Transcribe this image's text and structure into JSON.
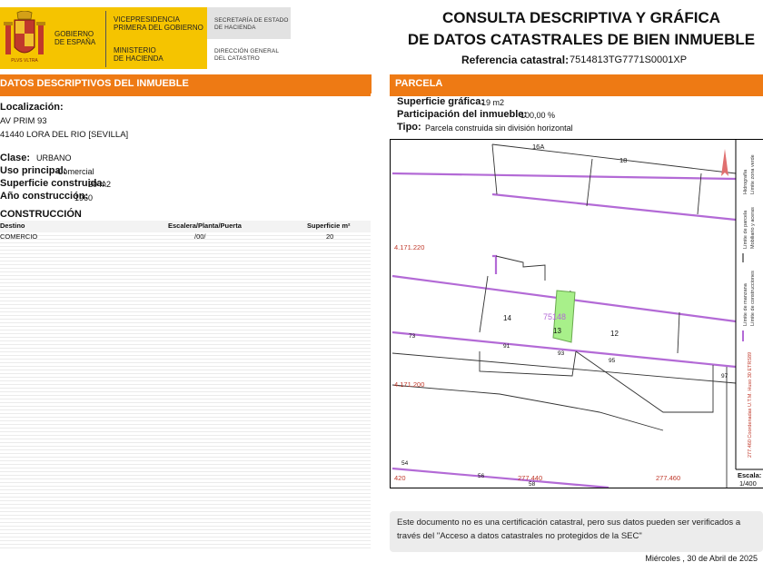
{
  "header": {
    "gov_line1": "GOBIERNO",
    "gov_line2": "DE ESPAÑA",
    "vice_line1": "VICEPRESIDENCIA",
    "vice_line2": "PRIMERA DEL GOBIERNO",
    "min_line1": "MINISTERIO",
    "min_line2": "DE HACIENDA",
    "secretaria_line1": "SECRETARÍA DE ESTADO",
    "secretaria_line2": "DE HACIENDA",
    "direccion_line1": "DIRECCIÓN GENERAL",
    "direccion_line2": "DEL CATASTRO"
  },
  "title": {
    "line1": "CONSULTA DESCRIPTIVA Y GRÁFICA",
    "line2": "DE DATOS CATASTRALES DE BIEN INMUEBLE",
    "ref_label": "Referencia catastral:",
    "ref_value": "7514813TG7771S0001XP"
  },
  "left": {
    "section_title": "DATOS DESCRIPTIVOS DEL INMUEBLE",
    "localizacion_label": "Localización:",
    "address_line1": "AV PRIM 93",
    "address_line2": "41440 LORA DEL RIO [SEVILLA]",
    "clase_label": "Clase:",
    "clase_value": "URBANO",
    "uso_label": "Uso principal:",
    "uso_value": "Comercial",
    "superficie_label": "Superficie construida:",
    "superficie_value": "20 m2",
    "anio_label": "Año construcción:",
    "anio_value": "1960",
    "construccion_title": "CONSTRUCCIÓN",
    "table": {
      "headers": [
        "Destino",
        "Escalera/Planta/Puerta",
        "Superficie m²"
      ],
      "rows": [
        [
          "COMERCIO",
          "/00/",
          "20"
        ]
      ]
    }
  },
  "right": {
    "section_title": "PARCELA",
    "sup_grafica_label": "Superficie gráfica:",
    "sup_grafica_value": "19 m2",
    "participacion_label": "Participación del inmueble:",
    "participacion_value": "100,00 %",
    "tipo_label": "Tipo:",
    "tipo_value": "Parcela construida sin división horizontal"
  },
  "map": {
    "labels": {
      "n16a": "16A",
      "n18": "18",
      "n14": "14",
      "n13": "13",
      "n12": "12",
      "parcel": "75148",
      "n73": "73",
      "n91": "91",
      "n93": "93",
      "n95": "95",
      "n97": "97",
      "n54": "54",
      "n56": "56",
      "n58": "58"
    },
    "coords": {
      "y1": "4.171.220",
      "y2": "4.171.200",
      "x1": "420",
      "x2": "277.440",
      "x3": "277.460"
    },
    "legend": {
      "hidrografia": "Hidrografía",
      "limite_via": "Límite zona verde",
      "limite_parcela": "Límite de parcela",
      "mobiliario": "Mobiliario y aceras",
      "limite_manzana": "Límite de manzana",
      "limite_construcciones": "Límite de construcciones",
      "coord_text": "277.460 Coordenadas U.T.M. Huso 30 ETRS89"
    },
    "scale_label": "Escala:",
    "scale_value": "1/400",
    "colors": {
      "parcel_line": "#b36ad6",
      "highlight": "#a8f08a",
      "coord_text": "#c0392b"
    }
  },
  "notice": {
    "text": "Este documento no es una certificación catastral, pero sus datos pueden ser verificados a través del \"Acceso a datos catastrales no protegidos de la SEC\""
  },
  "footer": {
    "date": "Miércoles , 30 de Abril de 2025"
  }
}
